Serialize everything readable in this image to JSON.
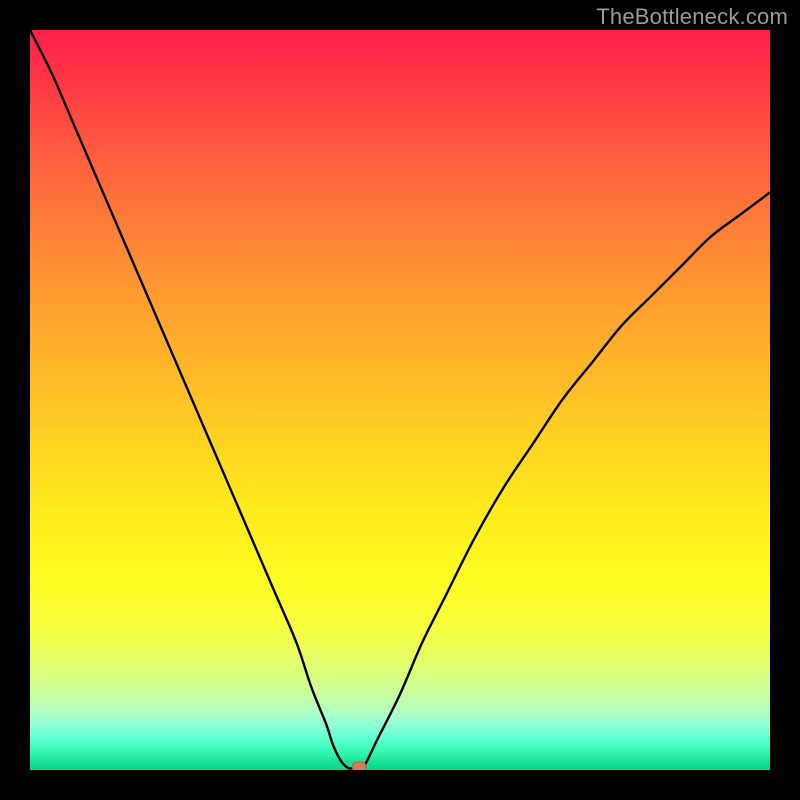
{
  "watermark": {
    "text": "TheBottleneck.com"
  },
  "colors": {
    "curve": "#000000",
    "marker_fill": "#d87a5c",
    "marker_stroke": "#c55a3d"
  },
  "chart_data": {
    "type": "line",
    "title": "",
    "xlabel": "",
    "ylabel": "",
    "xlim": [
      0,
      100
    ],
    "ylim": [
      0,
      100
    ],
    "grid": false,
    "legend": false,
    "series": [
      {
        "name": "bottleneck-curve",
        "x": [
          0,
          3,
          6,
          9,
          12,
          15,
          18,
          21,
          24,
          27,
          30,
          33,
          36,
          38,
          40,
          41,
          42,
          43,
          44,
          45,
          47,
          50,
          53,
          56,
          60,
          64,
          68,
          72,
          76,
          80,
          84,
          88,
          92,
          96,
          100
        ],
        "y": [
          100,
          94,
          87,
          80,
          73,
          66,
          59,
          52,
          45,
          38,
          31,
          24,
          17,
          11,
          6,
          3,
          1,
          0,
          0,
          0,
          4,
          10,
          17,
          23,
          31,
          38,
          44,
          50,
          55,
          60,
          64,
          68,
          72,
          75,
          78
        ]
      }
    ],
    "marker": {
      "x": 44.5,
      "y": 0
    },
    "flat_segment": {
      "x_start": 42,
      "x_end": 45,
      "y": 0
    }
  }
}
